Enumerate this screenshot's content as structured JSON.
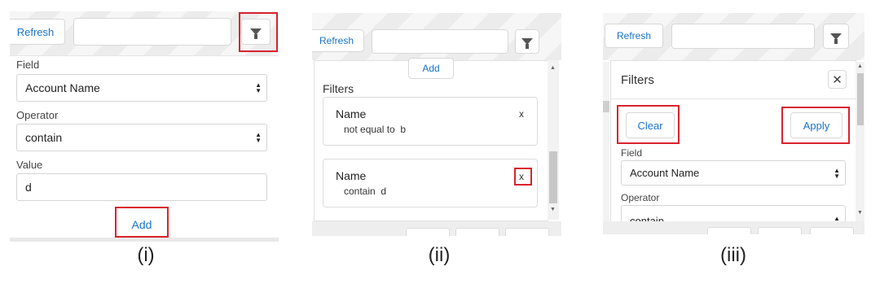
{
  "panel_i": {
    "refresh": "Refresh",
    "field_label": "Field",
    "field_value": "Account Name",
    "operator_label": "Operator",
    "operator_value": "contain",
    "value_label": "Value",
    "value_value": "d",
    "add": "Add",
    "caption": "(i)"
  },
  "panel_ii": {
    "refresh": "Refresh",
    "add": "Add",
    "filters_label": "Filters",
    "filters": [
      {
        "name": "Name",
        "condition": "not equal to  b",
        "remove": "x"
      },
      {
        "name": "Name",
        "condition": "contain  d",
        "remove": "x"
      }
    ],
    "caption": "(ii)"
  },
  "panel_iii": {
    "refresh": "Refresh",
    "filters_title": "Filters",
    "clear": "Clear",
    "apply": "Apply",
    "field_label": "Field",
    "field_value": "Account Name",
    "operator_label": "Operator",
    "operator_value": "contain",
    "caption": "(iii)"
  },
  "colors": {
    "highlight": "#d9232e",
    "link": "#1a73c7"
  },
  "icons": [
    "filter-icon",
    "close-icon",
    "chevron-updown-icon",
    "scroll-up-icon",
    "scroll-down-icon"
  ]
}
